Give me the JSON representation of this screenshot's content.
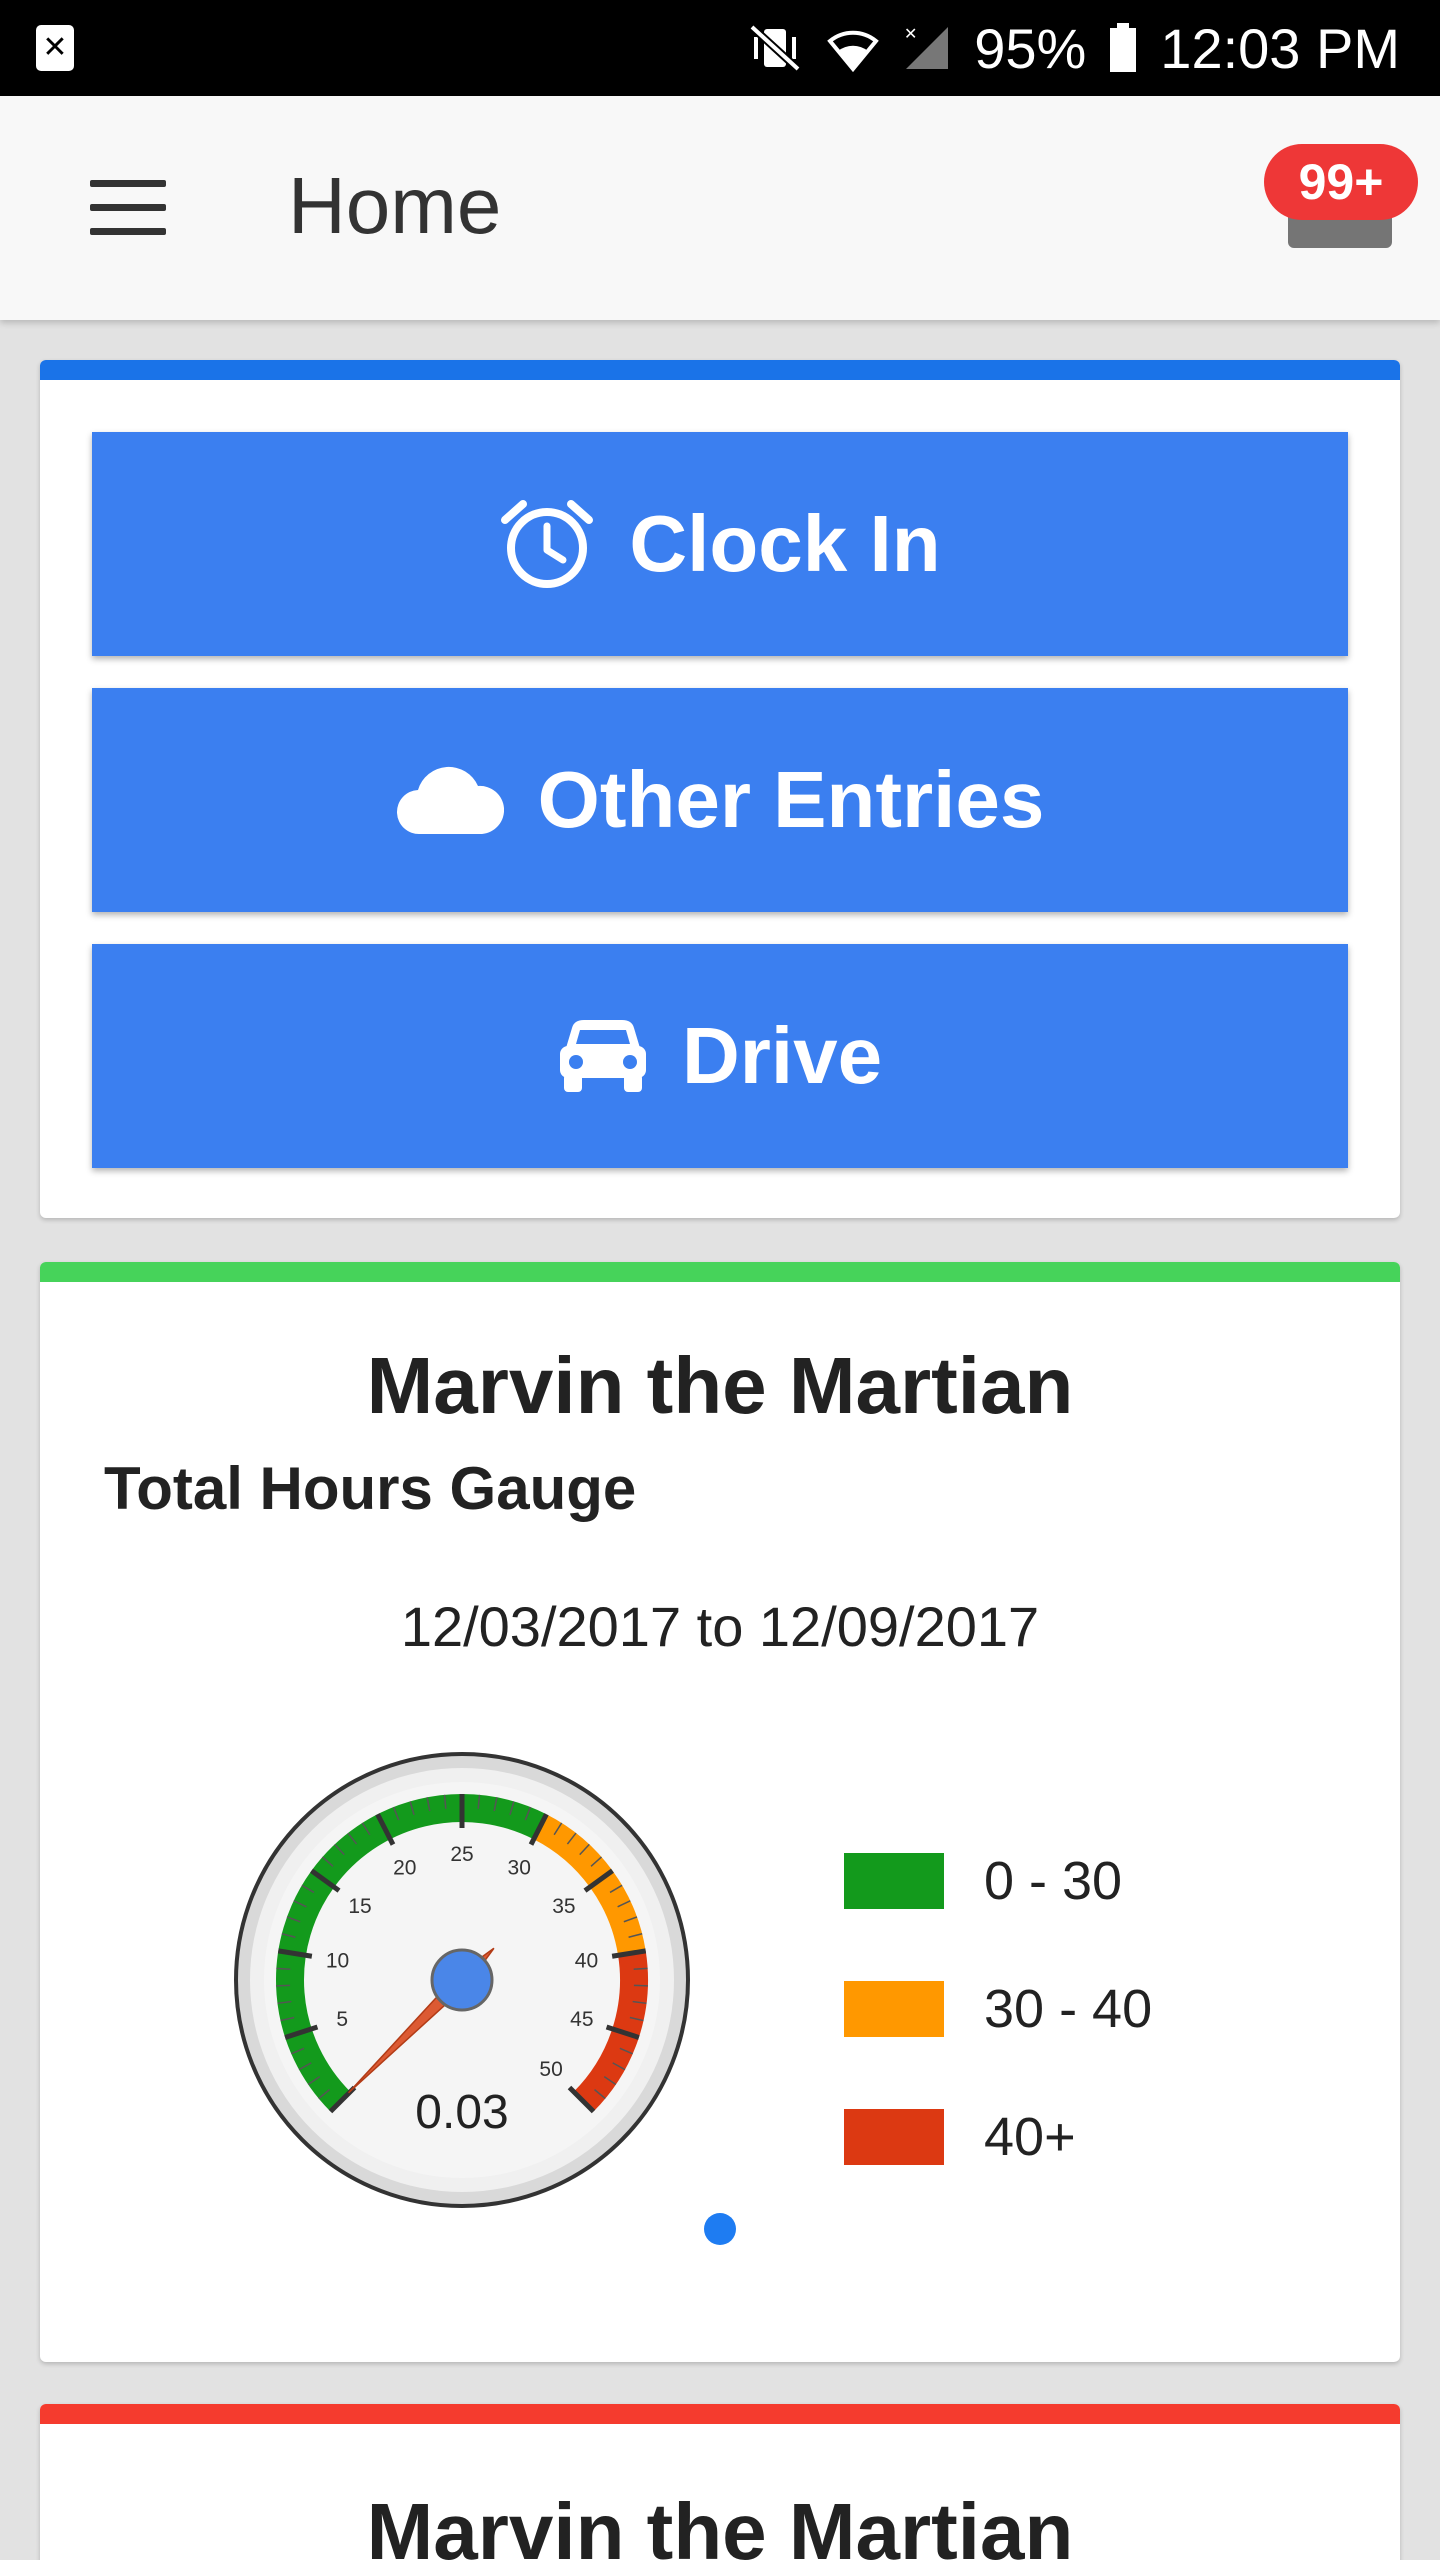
{
  "status_bar": {
    "notification_icon": "close-notification-icon",
    "battery": "95%",
    "time": "12:03 PM",
    "icons": [
      "vibrate-icon",
      "wifi-icon",
      "signal-icon",
      "battery-icon"
    ]
  },
  "app_bar": {
    "title": "Home",
    "menu_icon": "menu-icon",
    "notification_badge": "99+"
  },
  "actions": {
    "accent_color": "#1a73e8",
    "button_color": "#3b7ff0",
    "buttons": [
      {
        "label": "Clock In",
        "icon": "alarm-clock-icon"
      },
      {
        "label": "Other Entries",
        "icon": "cloud-icon"
      },
      {
        "label": "Drive",
        "icon": "car-icon"
      }
    ]
  },
  "gauge_card": {
    "accent_color": "#46d35a",
    "name": "Marvin the Martian",
    "title": "Total Hours Gauge",
    "date_range": "12/03/2017 to 12/09/2017",
    "gauge": {
      "value": 0.03,
      "value_label": "0.03",
      "min": 0,
      "max": 50,
      "ticks": [
        "5",
        "10",
        "15",
        "20",
        "25",
        "30",
        "35",
        "40",
        "45",
        "50"
      ],
      "bands": [
        {
          "from": 0,
          "to": 30,
          "color": "#139a1c"
        },
        {
          "from": 30,
          "to": 40,
          "color": "#ff9800"
        },
        {
          "from": 40,
          "to": 50,
          "color": "#dc3912"
        }
      ]
    },
    "legend": [
      {
        "label": "0 - 30",
        "color": "#139a1c"
      },
      {
        "label": "30 - 40",
        "color": "#ff9800"
      },
      {
        "label": "40+",
        "color": "#dc3912"
      }
    ]
  },
  "third_card": {
    "accent_color": "#f53b2e",
    "name": "Marvin the Martian"
  }
}
